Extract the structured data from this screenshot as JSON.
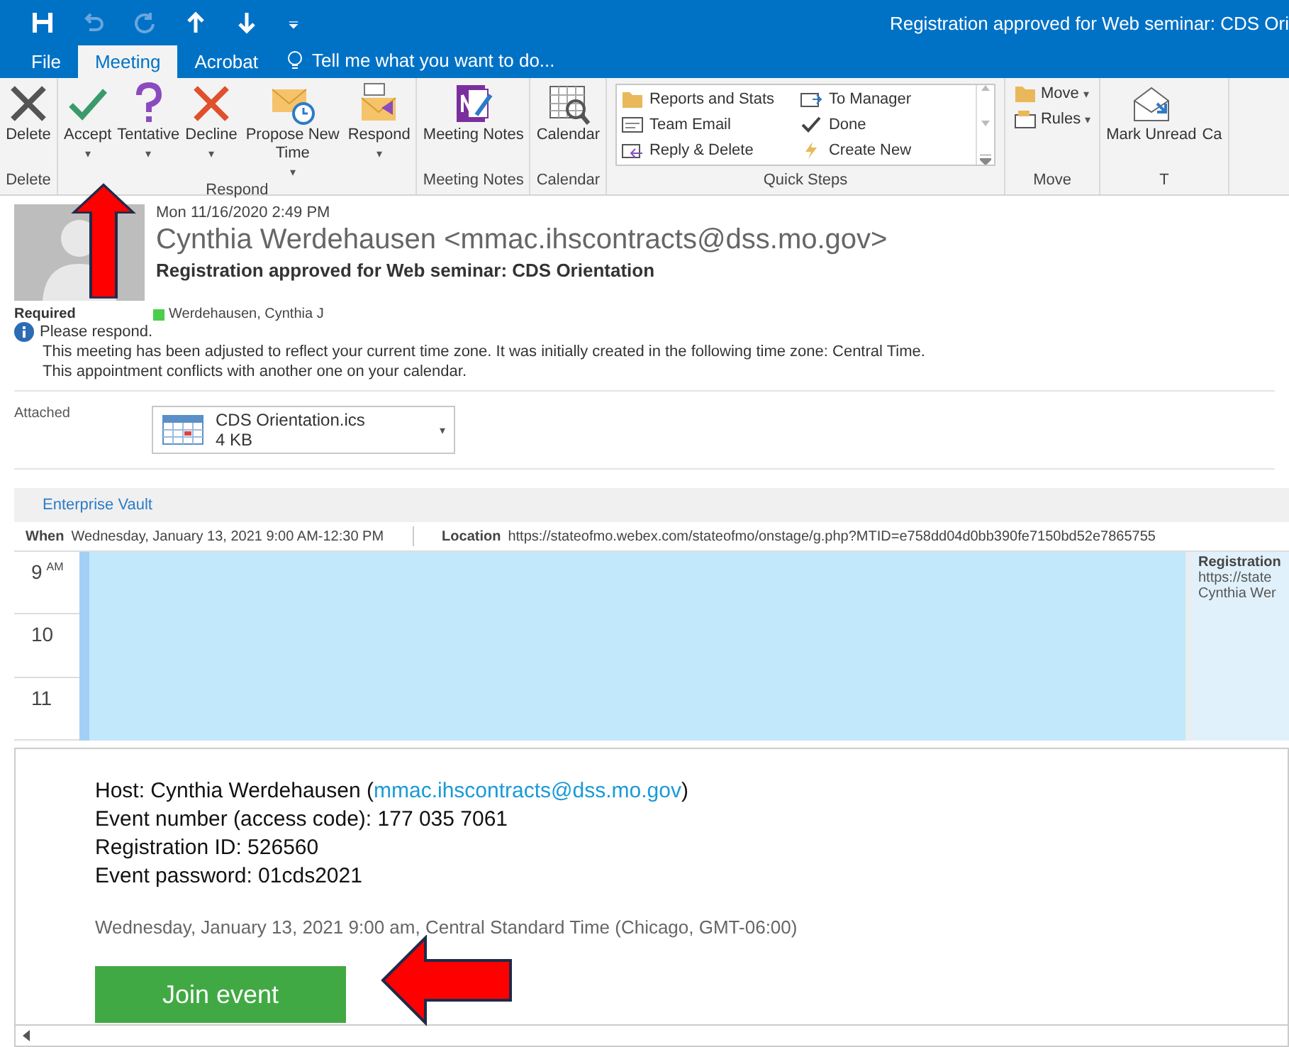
{
  "window": {
    "title": "Registration approved for Web seminar: CDS Ori"
  },
  "tabs": [
    {
      "label": "File",
      "selected": false
    },
    {
      "label": "Meeting",
      "selected": true
    },
    {
      "label": "Acrobat",
      "selected": false
    }
  ],
  "tell_me": {
    "placeholder": "Tell me what you want to do..."
  },
  "ribbon_groups": [
    {
      "label": "Delete",
      "kind": "large",
      "buttons": [
        {
          "label": "Delete"
        }
      ]
    },
    {
      "label": "Respond",
      "kind": "large",
      "buttons": [
        {
          "label": "Accept",
          "caret": "▾"
        },
        {
          "label": "Tentative",
          "caret": "▾"
        },
        {
          "label": "Decline",
          "caret": "▾"
        },
        {
          "label": "Propose New Time",
          "caret": "▾"
        },
        {
          "label": "Respond",
          "caret": "▾"
        }
      ]
    },
    {
      "label": "Meeting Notes",
      "kind": "large",
      "buttons": [
        {
          "label": "Meeting Notes"
        }
      ]
    },
    {
      "label": "Calendar",
      "kind": "large",
      "buttons": [
        {
          "label": "Calendar"
        }
      ]
    },
    {
      "label": "Quick Steps",
      "kind": "gallery",
      "items": [
        {
          "label": "Reports and Stats"
        },
        {
          "label": "To Manager"
        },
        {
          "label": "Team Email"
        },
        {
          "label": "Done"
        },
        {
          "label": "Reply & Delete"
        },
        {
          "label": "Create New"
        }
      ]
    },
    {
      "label": "Move",
      "kind": "small",
      "buttons": [
        {
          "label": "Move",
          "caret": "▾"
        },
        {
          "label": "Rules",
          "caret": "▾"
        }
      ]
    },
    {
      "label": "T",
      "kind": "large",
      "buttons": [
        {
          "label": "Mark Unread"
        },
        {
          "label": "Ca"
        }
      ]
    }
  ],
  "message": {
    "date": "Mon 11/16/2020 2:49 PM",
    "from": "Cynthia Werdehausen <mmac.ihscontracts@dss.mo.gov>",
    "subject": "Registration approved for Web seminar: CDS Orientation",
    "required_label": "Required",
    "attendee": {
      "name": "Werdehausen, Cynthia J",
      "color": "#4ccd4c"
    },
    "info": [
      "Please respond.",
      "This meeting has been adjusted to reflect your current time zone. It was initially created in the following time zone: Central Time.",
      "This appointment conflicts with another one on your calendar."
    ],
    "attached_label": "Attached",
    "attachment": {
      "name": "CDS Orientation.ics",
      "size": "4 KB",
      "caret": "▾"
    }
  },
  "enterprise_vault": "Enterprise Vault",
  "when": {
    "label": "When",
    "value": "Wednesday, January 13, 2021 9:00 AM-12:30 PM"
  },
  "location": {
    "label": "Location",
    "value": "https://stateofmo.webex.com/stateofmo/onstage/g.php?MTID=e758dd04d0bb390fe7150bd52e7865755"
  },
  "calendar": {
    "hours": [
      {
        "hour": "9",
        "suffix": "AM"
      },
      {
        "hour": "10"
      },
      {
        "hour": "11"
      }
    ],
    "side_event": {
      "title": "Registration",
      "lines": [
        "https://state",
        "Cynthia Wer"
      ]
    }
  },
  "body": {
    "host_prefix": "Host: Cynthia Werdehausen (",
    "host_link": "mmac.ihscontracts@dss.mo.gov",
    "host_suffix": ")",
    "lines": [
      "Event number (access code): 177 035 7061",
      "Registration ID: 526560",
      "Event password: 01cds2021"
    ],
    "date_line": "Wednesday, January 13, 2021 9:00 am, Central Standard Time (Chicago, GMT-06:00)",
    "button": "Join event"
  }
}
